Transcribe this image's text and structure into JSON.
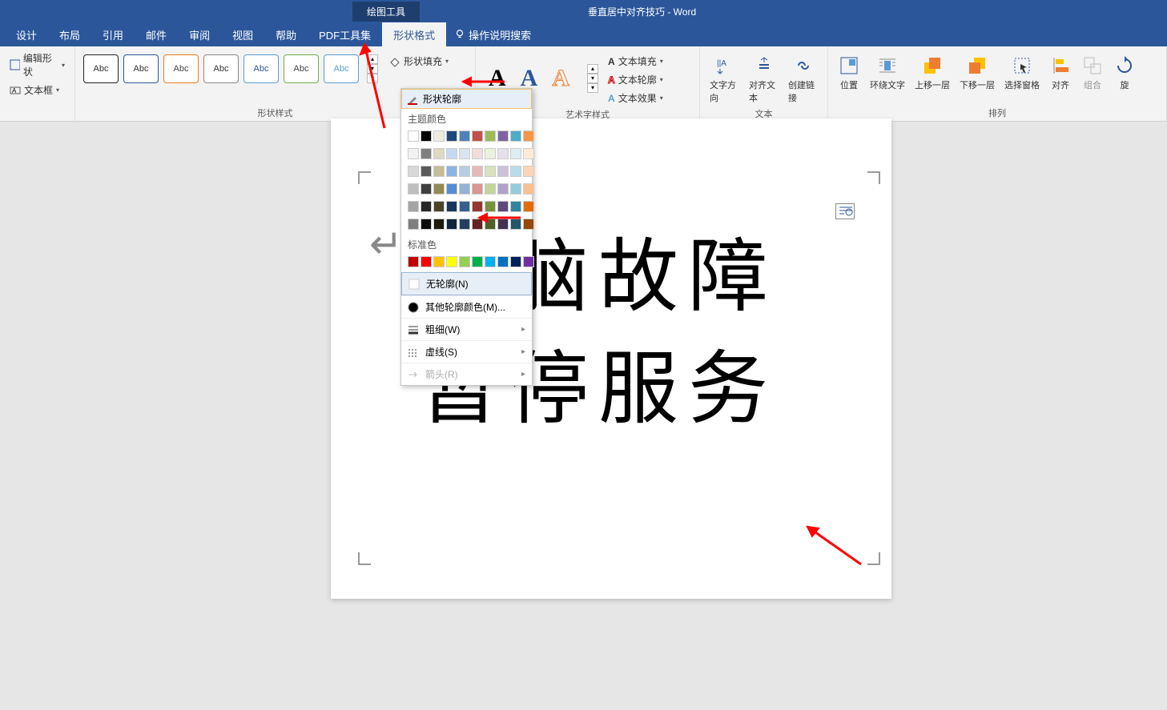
{
  "title_bar": {
    "tool_tab": "绘图工具",
    "doc_title": "垂直居中对齐技巧 - Word"
  },
  "tabs": {
    "items": [
      "设计",
      "布局",
      "引用",
      "邮件",
      "审阅",
      "视图",
      "帮助",
      "PDF工具集",
      "形状格式"
    ],
    "active_index": 8,
    "tell_me": "操作说明搜索"
  },
  "ribbon": {
    "insert_group": {
      "edit_shape": "编辑形状",
      "textbox": "文本框"
    },
    "shape_styles": {
      "label": "形状样式",
      "gallery_labels": [
        "Abc",
        "Abc",
        "Abc",
        "Abc",
        "Abc",
        "Abc",
        "Abc"
      ],
      "fill": "形状填充",
      "outline": "形状轮廓"
    },
    "wordart": {
      "label": "艺术字样式",
      "glyphs": [
        "A",
        "A",
        "A"
      ],
      "text_fill": "文本填充",
      "text_outline": "文本轮廓",
      "text_effect": "文本效果"
    },
    "text_group": {
      "label": "文本",
      "direction": "文字方向",
      "align": "对齐文本",
      "link": "创建链接"
    },
    "arrange": {
      "label": "排列",
      "position": "位置",
      "wrap": "环绕文字",
      "forward": "上移一层",
      "backward": "下移一层",
      "selection": "选择窗格",
      "align_btn": "对齐",
      "group_btn": "组合",
      "rotate": "旋"
    }
  },
  "dropdown": {
    "header": "形状轮廓",
    "theme_label": "主题颜色",
    "theme_row1": [
      "#ffffff",
      "#000000",
      "#eeece1",
      "#1f497d",
      "#4f81bd",
      "#c0504d",
      "#9bbb59",
      "#8064a2",
      "#4bacc6",
      "#f79646"
    ],
    "theme_shades": [
      [
        "#f2f2f2",
        "#7f7f7f",
        "#ddd9c3",
        "#c6d9f0",
        "#dbe5f1",
        "#f2dcdb",
        "#ebf1dd",
        "#e5e0ec",
        "#dbeef3",
        "#fdeada"
      ],
      [
        "#d8d8d8",
        "#595959",
        "#c4bd97",
        "#8db3e2",
        "#b8cce4",
        "#e5b9b7",
        "#d7e3bc",
        "#ccc1d9",
        "#b7dde8",
        "#fbd5b5"
      ],
      [
        "#bfbfbf",
        "#3f3f3f",
        "#938953",
        "#548dd4",
        "#95b3d7",
        "#d99694",
        "#c3d69b",
        "#b2a2c7",
        "#92cddc",
        "#fac08f"
      ],
      [
        "#a5a5a5",
        "#262626",
        "#494429",
        "#17365d",
        "#366092",
        "#953734",
        "#76923c",
        "#5f497a",
        "#31859b",
        "#e36c09"
      ],
      [
        "#7f7f7f",
        "#0c0c0c",
        "#1d1b10",
        "#0f243e",
        "#244061",
        "#632423",
        "#4f6128",
        "#3f3151",
        "#205867",
        "#974806"
      ]
    ],
    "standard_label": "标准色",
    "standard_colors": [
      "#c00000",
      "#ff0000",
      "#ffc000",
      "#ffff00",
      "#92d050",
      "#00b050",
      "#00b0f0",
      "#0070c0",
      "#002060",
      "#7030a0"
    ],
    "no_outline": "无轮廓(N)",
    "more_colors": "其他轮廓颜色(M)...",
    "weight": "粗细(W)",
    "dashes": "虚线(S)",
    "arrows": "箭头(R)"
  },
  "document": {
    "line1": "电脑故障",
    "line2": "暂停服务"
  }
}
